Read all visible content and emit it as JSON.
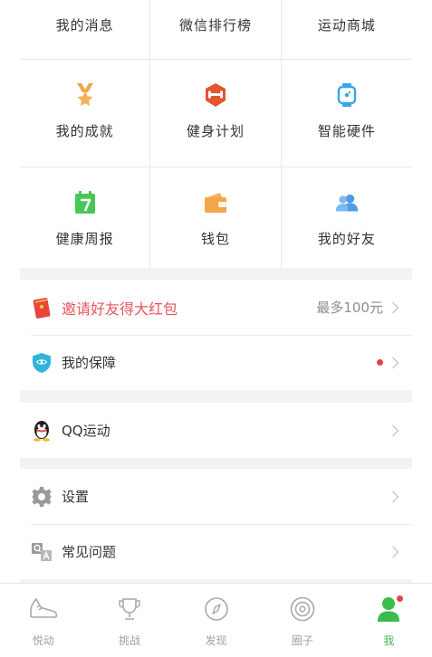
{
  "grid": {
    "rows": [
      [
        {
          "label": "我的消息"
        },
        {
          "label": "微信排行榜"
        },
        {
          "label": "运动商城"
        }
      ],
      [
        {
          "label": "我的成就",
          "icon": "medal-icon",
          "color": "#f0a84a"
        },
        {
          "label": "健身计划",
          "icon": "fitness-plan-icon",
          "color": "#e2552f"
        },
        {
          "label": "智能硬件",
          "icon": "smart-watch-icon",
          "color": "#3aa6e6"
        }
      ],
      [
        {
          "label": "健康周报",
          "icon": "calendar-icon",
          "color": "#49c65a",
          "icon_text": "7"
        },
        {
          "label": "钱包",
          "icon": "wallet-icon",
          "color": "#f3a64a"
        },
        {
          "label": "我的好友",
          "icon": "friends-icon",
          "color": "#4c9de2"
        }
      ]
    ]
  },
  "list": {
    "invite": {
      "label": "邀请好友得大红包",
      "right": "最多100元",
      "icon": "red-envelope-icon",
      "color": "#e8545b"
    },
    "insurance": {
      "label": "我的保障",
      "icon": "shield-icon",
      "color": "#2fb4dc"
    },
    "qq": {
      "label": "QQ运动",
      "icon": "qq-penguin-icon"
    },
    "settings": {
      "label": "设置",
      "icon": "gear-icon"
    },
    "faq": {
      "label": "常见问题",
      "icon": "qa-icon"
    }
  },
  "tabbar": {
    "tabs": [
      {
        "label": "悦动",
        "icon": "shoe-icon"
      },
      {
        "label": "挑战",
        "icon": "trophy-icon"
      },
      {
        "label": "发现",
        "icon": "compass-icon"
      },
      {
        "label": "圈子",
        "icon": "circle-target-icon"
      },
      {
        "label": "我",
        "icon": "user-icon",
        "active": true
      }
    ]
  },
  "colors": {
    "accent_green": "#3dbb4d",
    "badge_red": "#e8434b",
    "separator_gray": "#f3f3f3"
  }
}
